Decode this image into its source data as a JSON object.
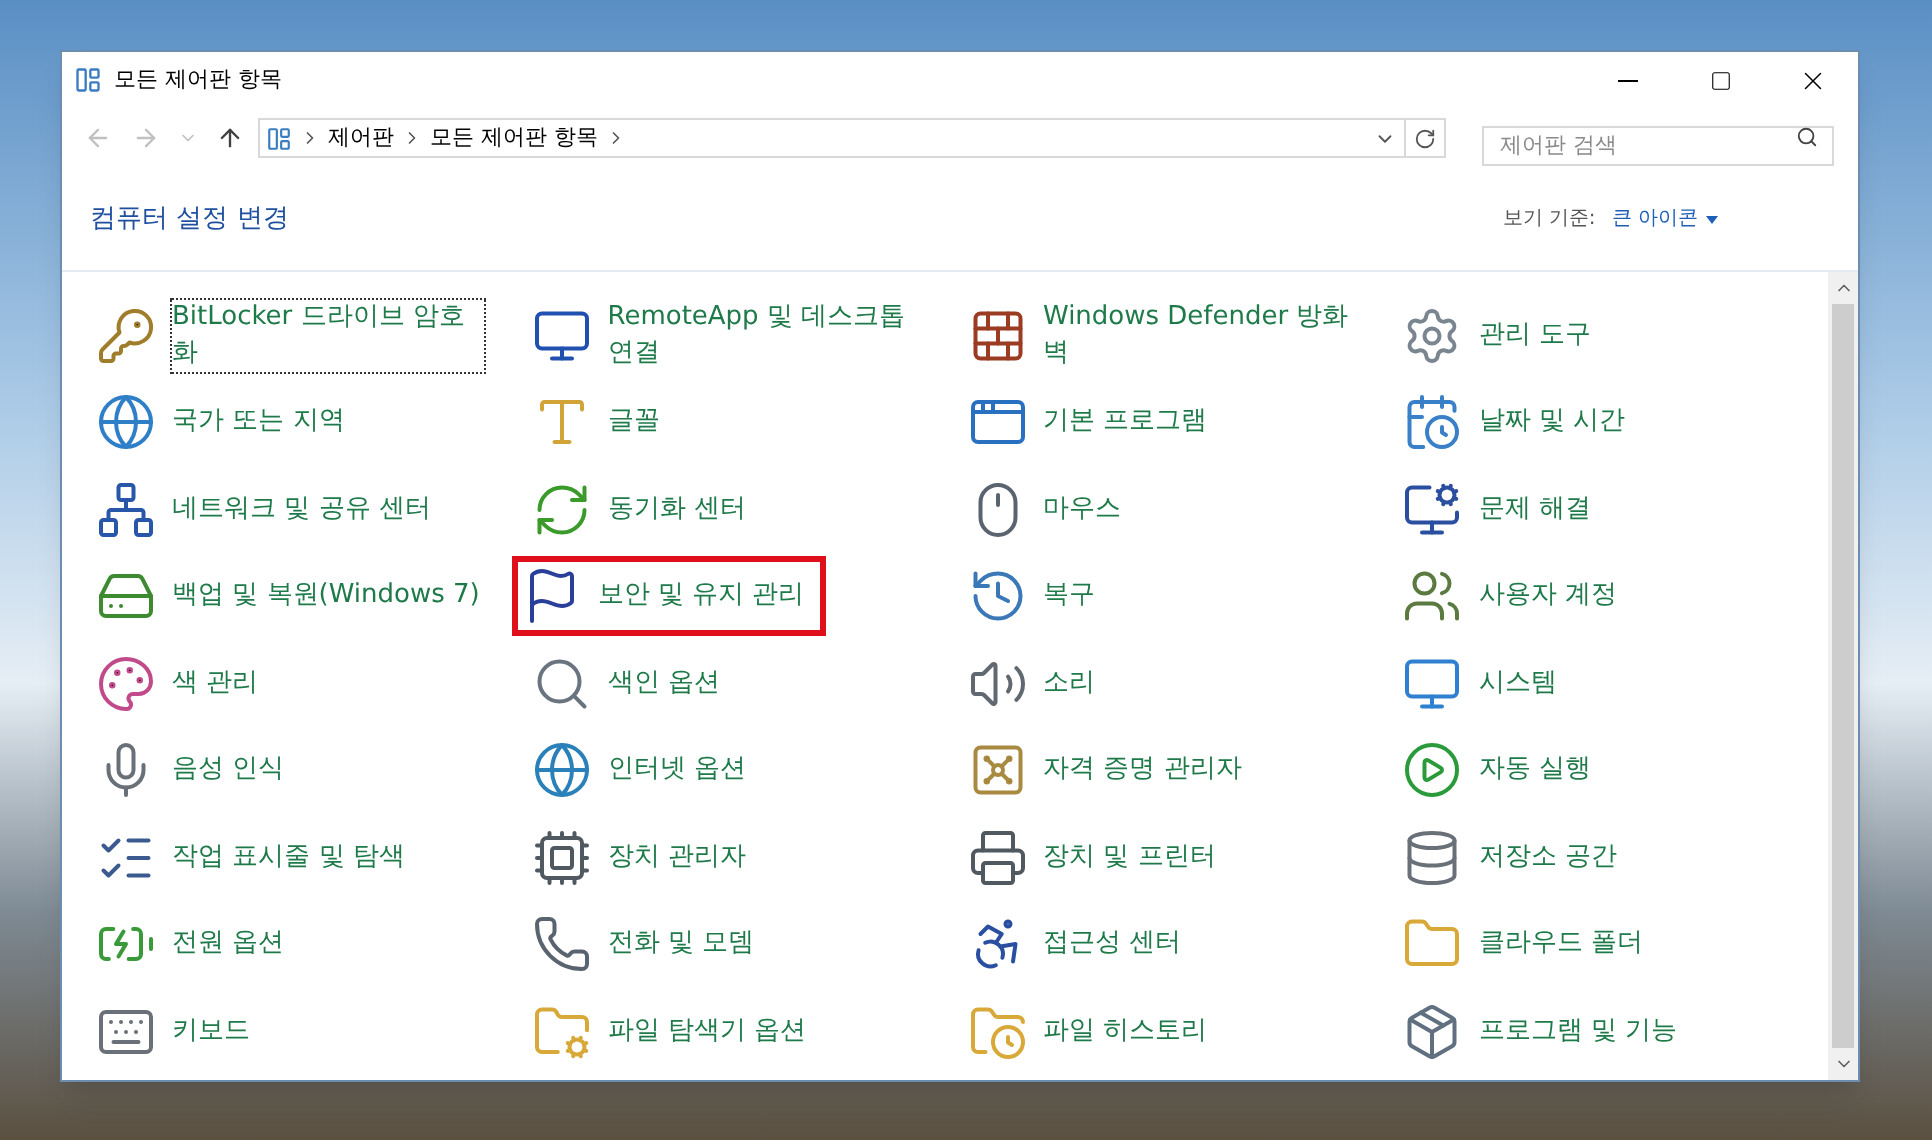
{
  "window": {
    "title": "모든 제어판 항목"
  },
  "address_bar": {
    "crumbs": [
      "제어판",
      "모든 제어판 항목"
    ]
  },
  "search": {
    "placeholder": "제어판 검색"
  },
  "header": {
    "title": "컴퓨터 설정 변경",
    "view_by_label": "보기 기준:",
    "view_by_value": "큰 아이콘"
  },
  "items": [
    {
      "label": "BitLocker 드라이브 암호화",
      "focused": true,
      "highlighted": false
    },
    {
      "label": "RemoteApp 및 데스크톱 연결",
      "focused": false,
      "highlighted": false
    },
    {
      "label": "Windows Defender 방화벽",
      "focused": false,
      "highlighted": false
    },
    {
      "label": "관리 도구",
      "focused": false,
      "highlighted": false
    },
    {
      "label": "국가 또는 지역",
      "focused": false,
      "highlighted": false
    },
    {
      "label": "글꼴",
      "focused": false,
      "highlighted": false
    },
    {
      "label": "기본 프로그램",
      "focused": false,
      "highlighted": false
    },
    {
      "label": "날짜 및 시간",
      "focused": false,
      "highlighted": false
    },
    {
      "label": "네트워크 및 공유 센터",
      "focused": false,
      "highlighted": false
    },
    {
      "label": "동기화 센터",
      "focused": false,
      "highlighted": false
    },
    {
      "label": "마우스",
      "focused": false,
      "highlighted": false
    },
    {
      "label": "문제 해결",
      "focused": false,
      "highlighted": false
    },
    {
      "label": "백업 및 복원(Windows 7)",
      "focused": false,
      "highlighted": false
    },
    {
      "label": "보안 및 유지 관리",
      "focused": false,
      "highlighted": true
    },
    {
      "label": "복구",
      "focused": false,
      "highlighted": false
    },
    {
      "label": "사용자 계정",
      "focused": false,
      "highlighted": false
    },
    {
      "label": "색 관리",
      "focused": false,
      "highlighted": false
    },
    {
      "label": "색인 옵션",
      "focused": false,
      "highlighted": false
    },
    {
      "label": "소리",
      "focused": false,
      "highlighted": false
    },
    {
      "label": "시스템",
      "focused": false,
      "highlighted": false
    },
    {
      "label": "음성 인식",
      "focused": false,
      "highlighted": false
    },
    {
      "label": "인터넷 옵션",
      "focused": false,
      "highlighted": false
    },
    {
      "label": "자격 증명 관리자",
      "focused": false,
      "highlighted": false
    },
    {
      "label": "자동 실행",
      "focused": false,
      "highlighted": false
    },
    {
      "label": "작업 표시줄 및 탐색",
      "focused": false,
      "highlighted": false
    },
    {
      "label": "장치 관리자",
      "focused": false,
      "highlighted": false
    },
    {
      "label": "장치 및 프린터",
      "focused": false,
      "highlighted": false
    },
    {
      "label": "저장소 공간",
      "focused": false,
      "highlighted": false
    },
    {
      "label": "전원 옵션",
      "focused": false,
      "highlighted": false
    },
    {
      "label": "전화 및 모뎀",
      "focused": false,
      "highlighted": false
    },
    {
      "label": "접근성 센터",
      "focused": false,
      "highlighted": false
    },
    {
      "label": "클라우드 폴더",
      "focused": false,
      "highlighted": false
    },
    {
      "label": "키보드",
      "focused": false,
      "highlighted": false
    },
    {
      "label": "파일 탐색기 옵션",
      "focused": false,
      "highlighted": false
    },
    {
      "label": "파일 히스토리",
      "focused": false,
      "highlighted": false
    },
    {
      "label": "프로그램 및 기능",
      "focused": false,
      "highlighted": false
    }
  ]
}
